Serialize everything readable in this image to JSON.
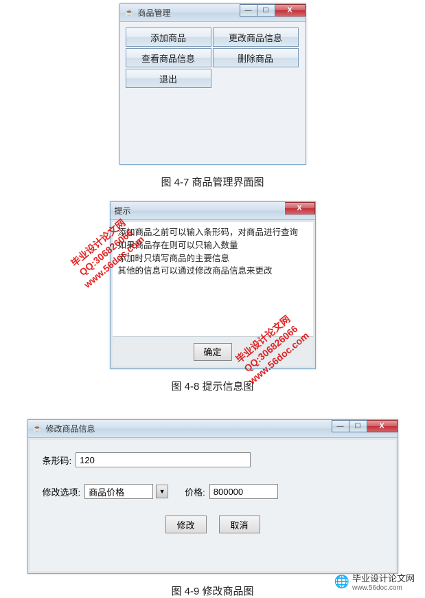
{
  "window1": {
    "title": "商品管理",
    "buttons": {
      "add": "添加商品",
      "edit": "更改商品信息",
      "view": "查看商品信息",
      "delete": "删除商品",
      "exit": "退出"
    }
  },
  "caption1": "图 4-7 商品管理界面图",
  "window2": {
    "title": "提示",
    "message_line1": "添加商品之前可以输入条形码，对商品进行查询",
    "message_line2": "如果商品存在则可以只输入数量",
    "message_line3": "添加时只填写商品的主要信息",
    "message_line4": "其他的信息可以通过修改商品信息来更改",
    "ok": "确定"
  },
  "caption2": "图 4-8 提示信息图",
  "window3": {
    "title": "修改商品信息",
    "barcode_label": "条形码:",
    "barcode_value": "120",
    "option_label": "修改选项:",
    "option_value": "商品价格",
    "price_label": "价格:",
    "price_value": "800000",
    "modify_btn": "修改",
    "cancel_btn": "取消"
  },
  "caption3": "图 4-9 修改商品图",
  "watermark": {
    "title": "毕业设计论文网",
    "qq": "QQ:306826066",
    "url": "www.56doc.com"
  },
  "footer": {
    "title": "毕业设计论文网",
    "url": "www.56doc.com"
  }
}
